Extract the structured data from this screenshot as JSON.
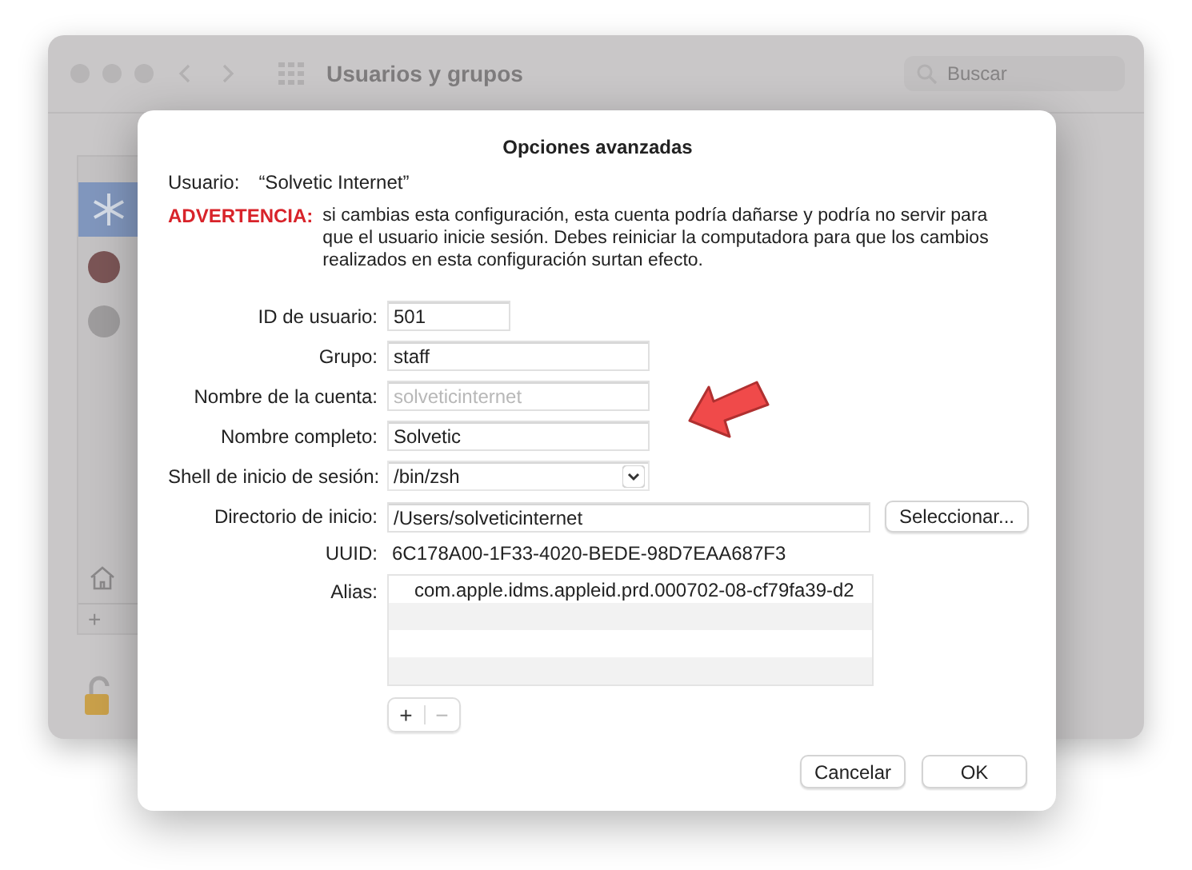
{
  "background_window": {
    "title": "Usuarios y grupos",
    "search": {
      "placeholder": "Buscar"
    },
    "sidebar": {
      "add_button": "+"
    }
  },
  "dialog": {
    "title": "Opciones avanzadas",
    "user_label": "Usuario:",
    "user_value": "“Solvetic Internet”",
    "warning_label": "ADVERTENCIA:",
    "warning_text": "si cambias esta configuración, esta cuenta podría dañarse y podría no servir para que el usuario inicie sesión. Debes reiniciar la computadora para que los cambios realizados en esta configuración surtan efecto.",
    "fields": [
      {
        "label": "ID de usuario:",
        "value": "501",
        "kind": "short",
        "disabled": false
      },
      {
        "label": "Grupo:",
        "value": "staff",
        "kind": "text",
        "disabled": false
      },
      {
        "label": "Nombre de la cuenta:",
        "value": "solveticinternet",
        "kind": "text",
        "disabled": true
      },
      {
        "label": "Nombre completo:",
        "value": "Solvetic",
        "kind": "text",
        "disabled": false
      },
      {
        "label": "Shell de inicio de sesión:",
        "value": "/bin/zsh",
        "kind": "popup",
        "disabled": false
      },
      {
        "label": "Directorio de inicio:",
        "value": "/Users/solveticinternet",
        "kind": "chooser",
        "disabled": false,
        "button": "Seleccionar..."
      }
    ],
    "uuid": {
      "label": "UUID:",
      "value": "6C178A00-1F33-4020-BEDE-98D7EAA687F3"
    },
    "alias": {
      "label": "Alias:",
      "items": [
        "com.apple.idms.appleid.prd.000702-08-cf79fa39-d2"
      ],
      "add": "+",
      "remove": "−"
    },
    "buttons": [
      "Cancelar",
      "OK"
    ]
  }
}
